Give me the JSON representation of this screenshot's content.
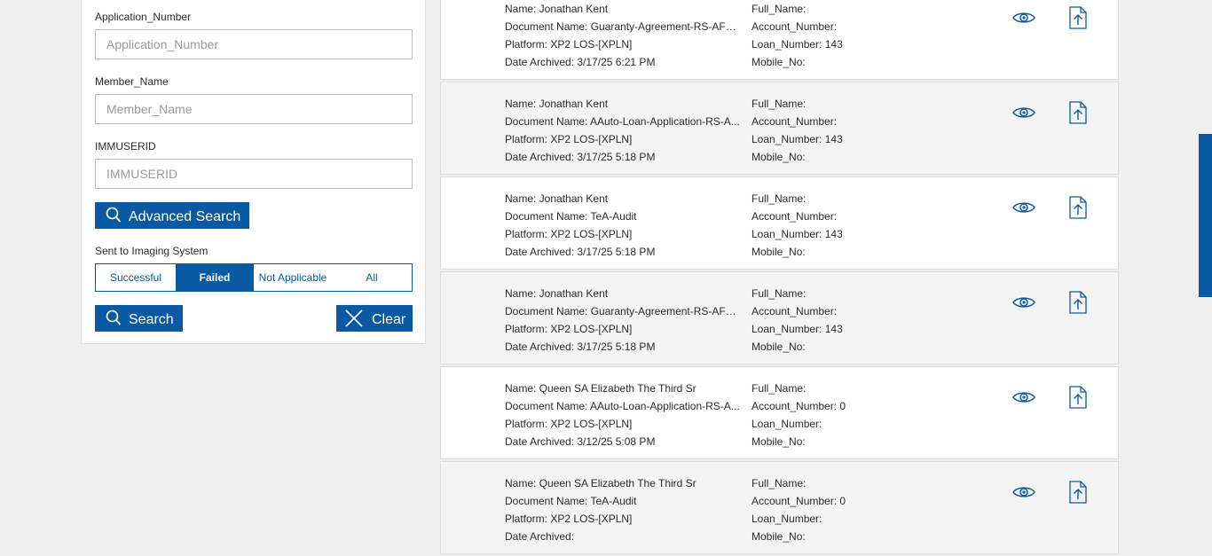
{
  "search_panel": {
    "application_number": {
      "label": "Application_Number",
      "placeholder": "Application_Number",
      "value": ""
    },
    "member_name": {
      "label": "Member_Name",
      "placeholder": "Member_Name",
      "value": ""
    },
    "immuserid": {
      "label": "IMMUSERID",
      "placeholder": "IMMUSERID",
      "value": ""
    },
    "advanced_search_label": "Advanced Search",
    "imaging_label": "Sent to Imaging System",
    "imaging_options": [
      "Successful",
      "Failed",
      "Not Applicable",
      "All"
    ],
    "imaging_selected": "Failed",
    "search_label": "Search",
    "clear_label": "Clear"
  },
  "results": [
    {
      "name": "Name: Jonathan Kent",
      "document": "Document Name: Guaranty-Agreement-RS-AFD...",
      "platform": "Platform: XP2 LOS-[XPLN]",
      "date": "Date Archived: 3/17/25 6:21 PM",
      "full_name": "Full_Name:",
      "account_number": "Account_Number:",
      "loan_number": "Loan_Number: 143",
      "mobile_no": "Mobile_No:"
    },
    {
      "name": "Name: Jonathan Kent",
      "document": "Document Name: AAuto-Loan-Application-RS-A...",
      "platform": "Platform: XP2 LOS-[XPLN]",
      "date": "Date Archived: 3/17/25 5:18 PM",
      "full_name": "Full_Name:",
      "account_number": "Account_Number:",
      "loan_number": "Loan_Number: 143",
      "mobile_no": "Mobile_No:"
    },
    {
      "name": "Name: Jonathan Kent",
      "document": "Document Name: TeA-Audit",
      "platform": "Platform: XP2 LOS-[XPLN]",
      "date": "Date Archived: 3/17/25 5:18 PM",
      "full_name": "Full_Name:",
      "account_number": "Account_Number:",
      "loan_number": "Loan_Number: 143",
      "mobile_no": "Mobile_No:"
    },
    {
      "name": "Name: Jonathan Kent",
      "document": "Document Name: Guaranty-Agreement-RS-AFD...",
      "platform": "Platform: XP2 LOS-[XPLN]",
      "date": "Date Archived: 3/17/25 5:18 PM",
      "full_name": "Full_Name:",
      "account_number": "Account_Number:",
      "loan_number": "Loan_Number: 143",
      "mobile_no": "Mobile_No:"
    },
    {
      "name": "Name: Queen SA Elizabeth The Third Sr",
      "document": "Document Name: AAuto-Loan-Application-RS-A...",
      "platform": "Platform: XP2 LOS-[XPLN]",
      "date": "Date Archived: 3/12/25 5:08 PM",
      "full_name": "Full_Name:",
      "account_number": "Account_Number: 0",
      "loan_number": "Loan_Number:",
      "mobile_no": "Mobile_No:"
    },
    {
      "name": "Name: Queen SA Elizabeth The Third Sr",
      "document": "Document Name: TeA-Audit",
      "platform": "Platform: XP2 LOS-[XPLN]",
      "date": "Date Archived:",
      "full_name": "Full_Name:",
      "account_number": "Account_Number: 0",
      "loan_number": "Loan_Number:",
      "mobile_no": "Mobile_No:"
    }
  ],
  "icons": {
    "view": "eye-icon",
    "upload": "upload-document-icon",
    "search": "search-icon",
    "clear": "close-icon"
  },
  "colors": {
    "accent": "#0a5aa3",
    "background": "#efefef",
    "row_alt": "#f4f4f4"
  }
}
